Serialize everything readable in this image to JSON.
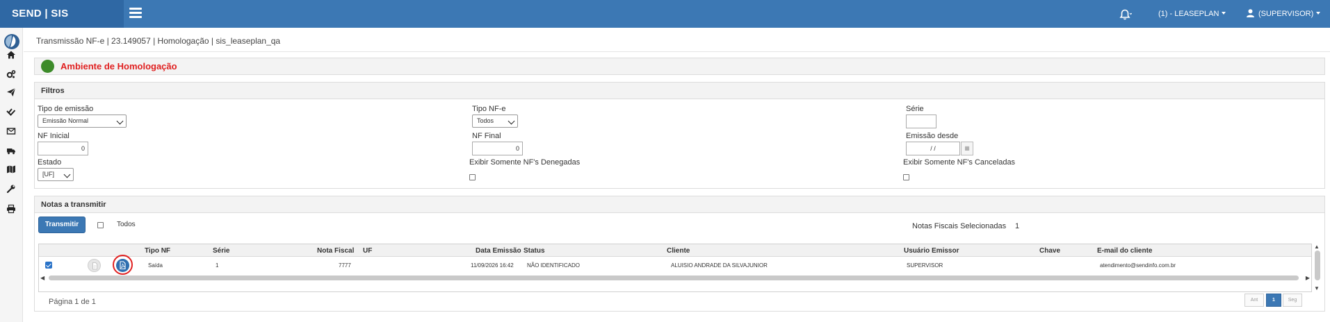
{
  "topbar": {
    "brand": "SEND | SIS",
    "company": "(1) - LEASEPLAN",
    "user": "(SUPERVISOR)"
  },
  "sidebar": {
    "icons": [
      "home-icon",
      "cogs-icon",
      "paper-plane-icon",
      "check-double-icon",
      "envelope-icon",
      "truck-icon",
      "map-icon",
      "wrench-icon",
      "print-icon"
    ]
  },
  "breadcrumb": "Transmissão NF-e | 23.149057 | Homologação | sis_leaseplan_qa",
  "environment": {
    "title": "Ambiente de Homologação",
    "status_color": "#3d8b2a"
  },
  "filters": {
    "title": "Filtros",
    "tipo_emissao_label": "Tipo de emissão",
    "tipo_emissao_value": "Emissão Normal",
    "tipo_nfe_label": "Tipo NF-e",
    "tipo_nfe_value": "Todos",
    "serie_label": "Série",
    "nf_inicial_label": "NF Inicial",
    "nf_inicial_value": "0",
    "nf_final_label": "NF Final",
    "nf_final_value": "0",
    "emissao_desde_label": "Emissão desde",
    "emissao_desde_value": "/ /",
    "estado_label": "Estado",
    "estado_value": "[UF]",
    "denegadas_label": "Exibir Somente NF's Denegadas",
    "canceladas_label": "Exibir Somente NF's Canceladas"
  },
  "notas": {
    "title": "Notas a transmitir",
    "transmit_label": "Transmitir",
    "todos_label": "Todos",
    "selected_label": "Notas Fiscais Selecionadas",
    "selected_count": "1",
    "columns": {
      "tipo_nf": "Tipo NF",
      "serie": "Série",
      "nota_fiscal": "Nota Fiscal",
      "uf": "UF",
      "data_emissao": "Data Emissão",
      "status": "Status",
      "cliente": "Cliente",
      "usuario_emissor": "Usuário Emissor",
      "chave": "Chave",
      "email": "E-mail do cliente"
    },
    "row": {
      "checked": true,
      "tipo_nf": "Saída",
      "serie": "1",
      "nota_fiscal": "7777",
      "uf": "",
      "data_emissao": "11/09/2026 16:42",
      "status": "NÃO IDENTIFICADO",
      "cliente": "ALUISIO ANDRADE DA SILVAJUNIOR",
      "usuario_emissor": "SUPERVISOR",
      "chave": "",
      "email": "atendimento@sendinfo.com.br"
    },
    "pagination": {
      "label": "Página 1 de 1",
      "prev": "Ant",
      "current": "1",
      "next": "Seg"
    }
  }
}
